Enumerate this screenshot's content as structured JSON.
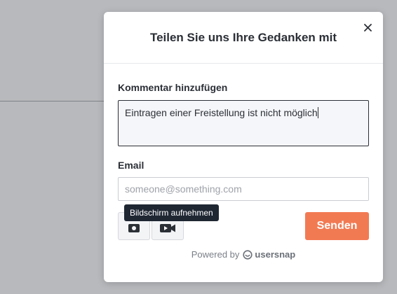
{
  "modal": {
    "title": "Teilen Sie uns Ihre Gedanken mit",
    "close_icon": "close-icon"
  },
  "comment": {
    "label": "Kommentar hinzufügen",
    "value": "Eintragen einer Freistellung ist nicht möglich"
  },
  "email": {
    "label": "Email",
    "placeholder": "someone@something.com",
    "value": ""
  },
  "tools": {
    "screenshot_icon": "camera-icon",
    "record_icon": "video-icon",
    "tooltip": "Bildschirm aufnehmen"
  },
  "send_label": "Senden",
  "footer": {
    "powered_by": "Powered by",
    "brand": "usersnap",
    "brand_icon": "usersnap-logo-icon"
  },
  "colors": {
    "send_button": "#f27a53",
    "tooltip_bg": "#1f2733",
    "backdrop": "#b7b9bc"
  }
}
